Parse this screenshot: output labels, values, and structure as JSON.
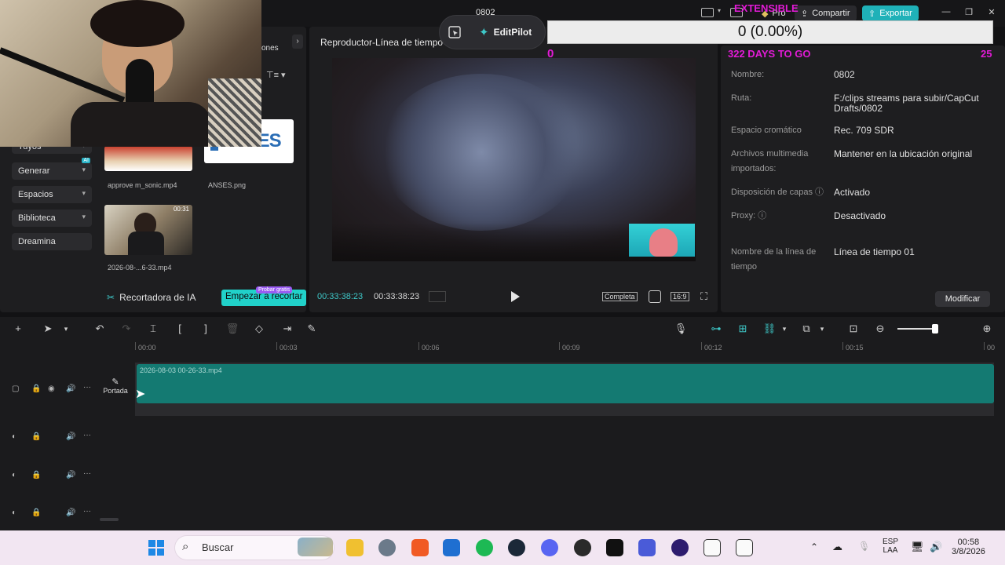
{
  "window": {
    "project_name": "0802",
    "pro_label": "Pro",
    "share_label": "Compartir",
    "export_label": "Exportar"
  },
  "overlay": {
    "progress_text": "0 (0.00%)",
    "left_count": "0",
    "days_text": "322 DAYS TO GO",
    "right_count": "25",
    "top_label": "EXTENSIBLE"
  },
  "media_panel": {
    "partial_tab": "ones",
    "nav": [
      {
        "label": "Tuyos"
      },
      {
        "label": "Generar",
        "badge": "AI"
      },
      {
        "label": "Espacios"
      },
      {
        "label": "Biblioteca"
      },
      {
        "label": "Dreamina"
      }
    ],
    "media": [
      {
        "name": "approve m_sonic.mp4"
      },
      {
        "name": "ANSES.png",
        "logo_text": "ANSES"
      },
      {
        "name": "2026-08-...6-33.mp4",
        "duration": "00:31"
      }
    ],
    "ai_recorder": "Recortadora de IA",
    "start_cut": "Empezar a recortar",
    "try_free": "Probar gratis"
  },
  "player": {
    "title": "Reproductor-Línea de tiempo",
    "current_time": "00:33:38:23",
    "total_time": "00:33:38:23",
    "full_label": "Completa",
    "ratio_label": "16:9"
  },
  "editpilot": {
    "label": "EditPilot"
  },
  "details": {
    "rows": [
      {
        "key": "Nombre:",
        "value": "0802"
      },
      {
        "key": "Ruta:",
        "value": "F:/clips streams para subir/CapCut Drafts/0802"
      },
      {
        "key": "Espacio cromático",
        "value": "Rec. 709 SDR"
      },
      {
        "key": "Archivos multimedia importados:",
        "value": "Mantener en la ubicación original"
      },
      {
        "key": "Disposición de capas ⓘ",
        "value": "Activado"
      },
      {
        "key": "Proxy: ⓘ",
        "value": "Desactivado"
      },
      {
        "key": "Nombre de la línea de tiempo",
        "value": "Línea de tiempo 01"
      }
    ],
    "modify_label": "Modificar"
  },
  "timeline": {
    "ticks": [
      "00:00",
      "00:03",
      "00:06",
      "00:09",
      "00:12",
      "00:15",
      "00"
    ],
    "clip_name": "2026-08-03 00-26-33.mp4",
    "cover_label": "Portada"
  },
  "taskbar": {
    "search_placeholder": "Buscar",
    "lang": "ESP",
    "lang_sub": "LAA",
    "time": "00:58",
    "date": "3/8/2026"
  }
}
